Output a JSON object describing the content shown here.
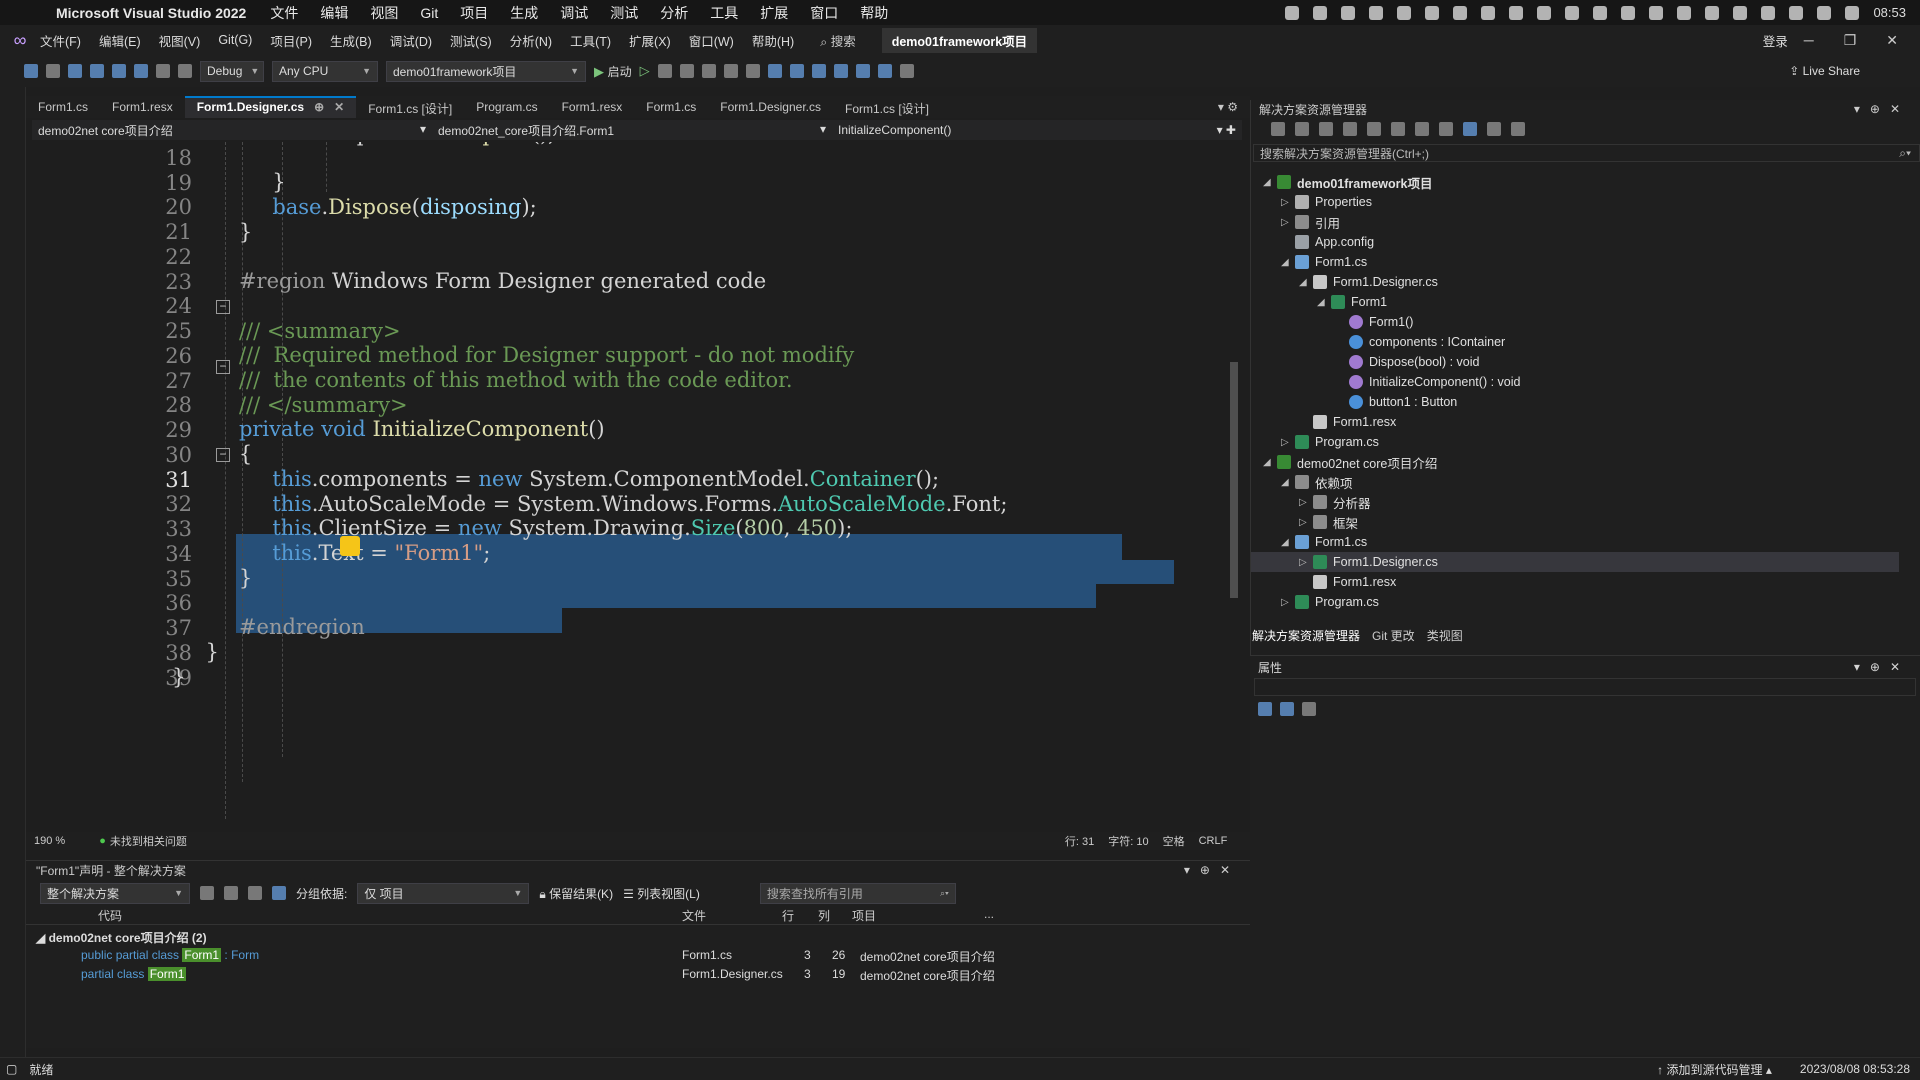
{
  "mac_menubar": {
    "app_name": "Microsoft Visual Studio 2022",
    "menus": [
      "文件",
      "编辑",
      "视图",
      "Git",
      "项目",
      "生成",
      "调试",
      "测试",
      "分析",
      "工具",
      "扩展",
      "窗口",
      "帮助"
    ],
    "clock": "08:53"
  },
  "vs_menubar": {
    "menus": [
      "文件(F)",
      "编辑(E)",
      "视图(V)",
      "Git(G)",
      "项目(P)",
      "生成(B)",
      "调试(D)",
      "测试(S)",
      "分析(N)",
      "工具(T)",
      "扩展(X)",
      "窗口(W)",
      "帮助(H)"
    ],
    "search_label": "搜索",
    "solution_name": "demo01framework项目",
    "login": "登录"
  },
  "toolbar": {
    "config": "Debug",
    "platform": "Any CPU",
    "startup_project": "demo01framework项目",
    "start_label": "启动",
    "live_share": "Live Share"
  },
  "tabs": [
    {
      "label": "Form1.cs"
    },
    {
      "label": "Form1.resx"
    },
    {
      "label": "Form1.Designer.cs"
    },
    {
      "label": "Form1.cs [设计]"
    },
    {
      "label": "Program.cs"
    },
    {
      "label": "Form1.resx"
    },
    {
      "label": "Form1.cs"
    },
    {
      "label": "Form1.Designer.cs"
    },
    {
      "label": "Form1.cs [设计]"
    }
  ],
  "navbar": {
    "project": "demo02net core项目介绍",
    "class": "demo02net_core项目介绍.Form1",
    "member": "InitializeComponent()"
  },
  "editor": {
    "line_numbers": [
      "18",
      "19",
      "20",
      "21",
      "22",
      "23",
      "24",
      "25",
      "26",
      "27",
      "28",
      "29",
      "30",
      "31",
      "32",
      "33",
      "34",
      "35",
      "36",
      "37",
      "38",
      "39"
    ],
    "current_line": "31"
  },
  "editor_status": {
    "zoom": "190 %",
    "issues": "未找到相关问题",
    "line": "行: 31",
    "char": "字符: 10",
    "whitespace": "空格",
    "eol": "CRLF"
  },
  "references_panel": {
    "title": "\"Form1\"声明 - 整个解决方案",
    "scope": "整个解决方案",
    "group_by_label": "分组依据:",
    "group_by_value": "仅 项目",
    "keep_results": "保留结果(K)",
    "list_view": "列表视图(L)",
    "search_placeholder": "搜索查找所有引用",
    "columns": {
      "code": "代码",
      "file": "文件",
      "line": "行",
      "col": "列",
      "project": "项目",
      "more": "..."
    },
    "group": "demo02net core项目介绍 (2)",
    "rows": [
      {
        "prefix": "public partial class ",
        "hl": "Form1",
        "suffix": " : Form",
        "file": "Form1.cs",
        "line": "3",
        "col": "26",
        "project": "demo02net core项目介绍"
      },
      {
        "prefix": "partial class ",
        "hl": "Form1",
        "suffix": "",
        "file": "Form1.Designer.cs",
        "line": "3",
        "col": "19",
        "project": "demo02net core项目介绍"
      }
    ]
  },
  "solution_explorer": {
    "title": "解决方案资源管理器",
    "search": "搜索解决方案资源管理器(Ctrl+;)",
    "tree": [
      {
        "label": "demo01framework项目",
        "level": 0,
        "arrow": "◢",
        "icon": "proj"
      },
      {
        "label": "Properties",
        "level": 1,
        "arrow": "▷",
        "icon": "wrench"
      },
      {
        "label": "引用",
        "level": 1,
        "arrow": "▷",
        "icon": "ref"
      },
      {
        "label": "App.config",
        "level": 1,
        "arrow": "",
        "icon": "cfg"
      },
      {
        "label": "Form1.cs",
        "level": 1,
        "arrow": "◢",
        "icon": "form"
      },
      {
        "label": "Form1.Designer.cs",
        "level": 2,
        "arrow": "◢",
        "icon": "file"
      },
      {
        "label": "Form1",
        "level": 3,
        "arrow": "◢",
        "icon": "cs"
      },
      {
        "label": "Form1()",
        "level": 4,
        "arrow": "",
        "icon": "member"
      },
      {
        "label": "components : IContainer",
        "level": 4,
        "arrow": "",
        "icon": "field"
      },
      {
        "label": "Dispose(bool) : void",
        "level": 4,
        "arrow": "",
        "icon": "member"
      },
      {
        "label": "InitializeComponent() : void",
        "level": 4,
        "arrow": "",
        "icon": "member"
      },
      {
        "label": "button1 : Button",
        "level": 4,
        "arrow": "",
        "icon": "field"
      },
      {
        "label": "Form1.resx",
        "level": 2,
        "arrow": "",
        "icon": "file"
      },
      {
        "label": "Program.cs",
        "level": 1,
        "arrow": "▷",
        "icon": "cs"
      },
      {
        "label": "demo02net core项目介绍",
        "level": 0,
        "arrow": "◢",
        "icon": "proj"
      },
      {
        "label": "依赖项",
        "level": 1,
        "arrow": "◢",
        "icon": "ref"
      },
      {
        "label": "分析器",
        "level": 2,
        "arrow": "▷",
        "icon": "ref"
      },
      {
        "label": "框架",
        "level": 2,
        "arrow": "▷",
        "icon": "ref"
      },
      {
        "label": "Form1.cs",
        "level": 1,
        "arrow": "◢",
        "icon": "form"
      },
      {
        "label": "Form1.Designer.cs",
        "level": 2,
        "arrow": "▷",
        "icon": "cs"
      },
      {
        "label": "Form1.resx",
        "level": 2,
        "arrow": "",
        "icon": "file"
      },
      {
        "label": "Program.cs",
        "level": 1,
        "arrow": "▷",
        "icon": "cs"
      }
    ],
    "selected": "Form1.Designer.cs",
    "bottom_tabs": [
      "解决方案资源管理器",
      "Git 更改",
      "类视图"
    ]
  },
  "properties_panel": {
    "title": "属性"
  },
  "statusbar": {
    "ready": "就绪",
    "source_control": "添加到源代码管理",
    "datetime": "2023/08/08 08:53:28"
  }
}
